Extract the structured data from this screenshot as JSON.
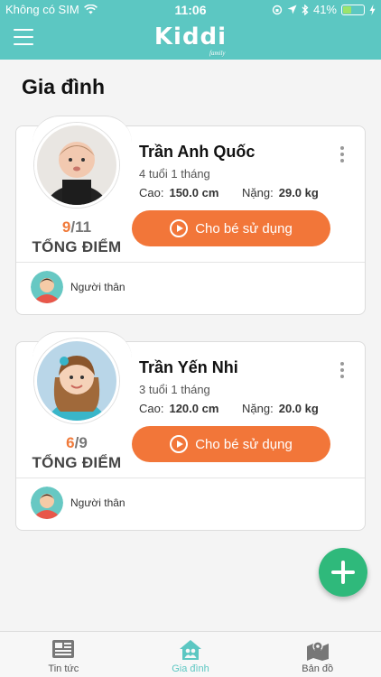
{
  "status_bar": {
    "carrier": "Không có SIM",
    "time": "11:06",
    "battery": "41%",
    "battery_level": 0.41
  },
  "header": {
    "logo": "Kiddi",
    "logo_sub": "family"
  },
  "page_title": "Gia đình",
  "children": [
    {
      "name": "Trần Anh Quốc",
      "age": "4 tuổi 1 tháng",
      "height_label": "Cao:",
      "height": "150.0 cm",
      "weight_label": "Nặng:",
      "weight": "29.0 kg",
      "score_done": "9",
      "score_total": "/11",
      "score_label": "TỔNG ĐIỂM",
      "use_button": "Cho bé sử dụng",
      "relatives_label": "Người thân"
    },
    {
      "name": "Trần Yến Nhi",
      "age": "3 tuổi 1 tháng",
      "height_label": "Cao:",
      "height": "120.0 cm",
      "weight_label": "Nặng:",
      "weight": "20.0 kg",
      "score_done": "6",
      "score_total": "/9",
      "score_label": "TỔNG ĐIỂM",
      "use_button": "Cho bé sử dụng",
      "relatives_label": "Người thân"
    }
  ],
  "tabs": [
    {
      "label": "Tin tức",
      "icon": "newspaper-icon"
    },
    {
      "label": "Gia đình",
      "icon": "home-family-icon",
      "active": true
    },
    {
      "label": "Bản đồ",
      "icon": "map-icon"
    }
  ],
  "colors": {
    "primary": "#5cc7c2",
    "accent": "#f27639",
    "fab": "#2fb97b"
  }
}
